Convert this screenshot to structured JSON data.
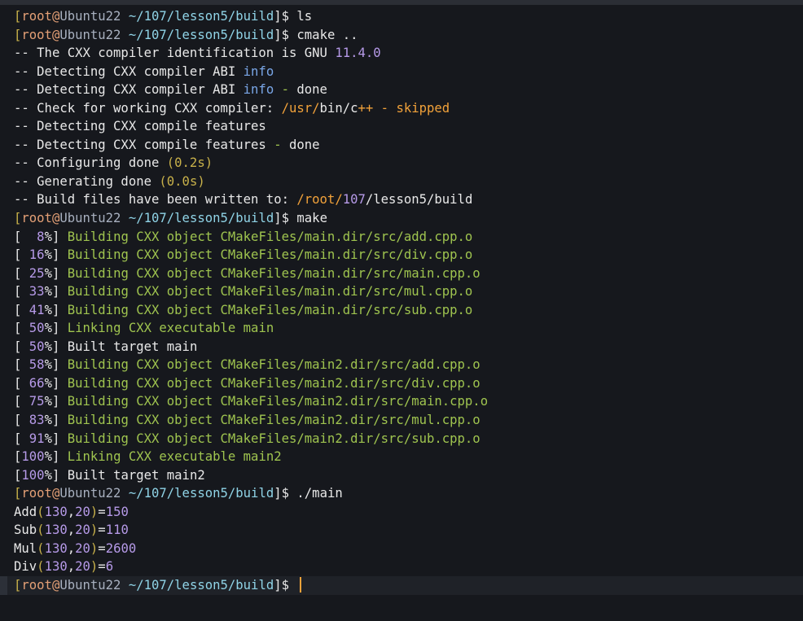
{
  "prompt": {
    "open": "[",
    "user": "root",
    "at": "@",
    "host": "Ubuntu22",
    "path": "~/107/lesson5/build",
    "close": "]$"
  },
  "lines": [
    {
      "type": "cmd",
      "cmd": "ls"
    },
    {
      "type": "cmd",
      "cmd": "cmake .."
    },
    {
      "type": "out",
      "parts": [
        {
          "t": "-- The CXX compiler identification is GNU ",
          "c": "w"
        },
        {
          "t": "11.4.0",
          "c": "p"
        }
      ]
    },
    {
      "type": "out",
      "parts": [
        {
          "t": "-- Detecting CXX compiler ABI ",
          "c": "w"
        },
        {
          "t": "info",
          "c": "b"
        }
      ]
    },
    {
      "type": "out",
      "parts": [
        {
          "t": "-- Detecting CXX compiler ABI ",
          "c": "w"
        },
        {
          "t": "info",
          "c": "b"
        },
        {
          "t": " - ",
          "c": "g"
        },
        {
          "t": "done",
          "c": "w"
        }
      ]
    },
    {
      "type": "out",
      "parts": [
        {
          "t": "-- Check for working CXX compiler: ",
          "c": "w"
        },
        {
          "t": "/usr/",
          "c": "o"
        },
        {
          "t": "bin/c",
          "c": "w"
        },
        {
          "t": "++ - skipped",
          "c": "o"
        }
      ]
    },
    {
      "type": "out",
      "parts": [
        {
          "t": "-- Detecting CXX compile features",
          "c": "w"
        }
      ]
    },
    {
      "type": "out",
      "parts": [
        {
          "t": "-- Detecting CXX compile features ",
          "c": "w"
        },
        {
          "t": "-",
          "c": "g"
        },
        {
          "t": " done",
          "c": "w"
        }
      ]
    },
    {
      "type": "out",
      "parts": [
        {
          "t": "-- Configuring done ",
          "c": "w"
        },
        {
          "t": "(0.2s)",
          "c": "y"
        }
      ]
    },
    {
      "type": "out",
      "parts": [
        {
          "t": "-- Generating done ",
          "c": "w"
        },
        {
          "t": "(0.0s)",
          "c": "y"
        }
      ]
    },
    {
      "type": "out",
      "parts": [
        {
          "t": "-- Build files have been written to: ",
          "c": "w"
        },
        {
          "t": "/root/",
          "c": "o"
        },
        {
          "t": "107",
          "c": "p"
        },
        {
          "t": "/lesson5/build",
          "c": "w"
        }
      ]
    },
    {
      "type": "cmd",
      "cmd": "make"
    },
    {
      "type": "build",
      "pct": "  8",
      "msg": "Building CXX object CMakeFiles/main.dir/src/add.cpp.o",
      "style": "g"
    },
    {
      "type": "build",
      "pct": " 16",
      "msg": "Building CXX object CMakeFiles/main.dir/src/div.cpp.o",
      "style": "g"
    },
    {
      "type": "build",
      "pct": " 25",
      "msg": "Building CXX object CMakeFiles/main.dir/src/main.cpp.o",
      "style": "g"
    },
    {
      "type": "build",
      "pct": " 33",
      "msg": "Building CXX object CMakeFiles/main.dir/src/mul.cpp.o",
      "style": "g"
    },
    {
      "type": "build",
      "pct": " 41",
      "msg": "Building CXX object CMakeFiles/main.dir/src/sub.cpp.o",
      "style": "g"
    },
    {
      "type": "build",
      "pct": " 50",
      "msg": "Linking CXX executable main",
      "style": "g"
    },
    {
      "type": "build",
      "pct": " 50",
      "msg": "Built target main",
      "style": "w"
    },
    {
      "type": "build",
      "pct": " 58",
      "msg": "Building CXX object CMakeFiles/main2.dir/src/add.cpp.o",
      "style": "g"
    },
    {
      "type": "build",
      "pct": " 66",
      "msg": "Building CXX object CMakeFiles/main2.dir/src/div.cpp.o",
      "style": "g"
    },
    {
      "type": "build",
      "pct": " 75",
      "msg": "Building CXX object CMakeFiles/main2.dir/src/main.cpp.o",
      "style": "g"
    },
    {
      "type": "build",
      "pct": " 83",
      "msg": "Building CXX object CMakeFiles/main2.dir/src/mul.cpp.o",
      "style": "g"
    },
    {
      "type": "build",
      "pct": " 91",
      "msg": "Building CXX object CMakeFiles/main2.dir/src/sub.cpp.o",
      "style": "g"
    },
    {
      "type": "build",
      "pct": "100",
      "msg": "Linking CXX executable main2",
      "style": "g"
    },
    {
      "type": "build",
      "pct": "100",
      "msg": "Built target main2",
      "style": "w"
    },
    {
      "type": "cmd",
      "cmd": "./main"
    },
    {
      "type": "calc",
      "op": "Add",
      "a": "130",
      "b": "20",
      "r": "150"
    },
    {
      "type": "calc",
      "op": "Sub",
      "a": "130",
      "b": "20",
      "r": "110"
    },
    {
      "type": "calc",
      "op": "Mul",
      "a": "130",
      "b": "20",
      "r": "2600"
    },
    {
      "type": "calc",
      "op": "Div",
      "a": "130",
      "b": "20",
      "r": "6"
    },
    {
      "type": "cmd",
      "cmd": "",
      "current": true
    }
  ],
  "colors": {
    "background": "#16181d",
    "prompt_bracket": "#c8b14a",
    "prompt_user": "#e4a076",
    "prompt_host": "#a8b0bf",
    "prompt_path": "#8fd3e6",
    "green": "#9fc44f",
    "purple": "#b69ae8",
    "orange": "#f2a23a",
    "blue": "#7aa7e8"
  }
}
